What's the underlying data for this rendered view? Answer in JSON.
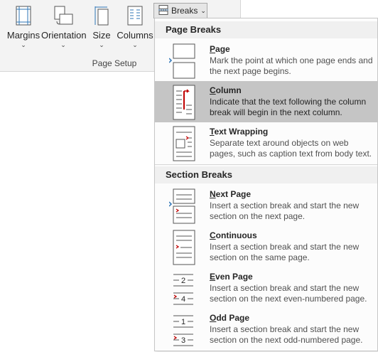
{
  "ribbon": {
    "group_label": "Page Setup",
    "buttons": [
      {
        "label": "Margins",
        "icon": "margins-icon"
      },
      {
        "label": "Orientation",
        "icon": "orientation-icon"
      },
      {
        "label": "Size",
        "icon": "size-icon"
      },
      {
        "label": "Columns",
        "icon": "columns-icon"
      }
    ],
    "breaks_label": "Breaks",
    "chevron": "⌄"
  },
  "menu": {
    "page_breaks_header": "Page Breaks",
    "section_breaks_header": "Section Breaks",
    "page_breaks": [
      {
        "mnemonic": "P",
        "rest": "age",
        "desc": "Mark the point at which one page ends and the next page begins.",
        "icon": "page-break-icon"
      },
      {
        "mnemonic": "C",
        "rest": "olumn",
        "desc": "Indicate that the text following the column break will begin in the next column.",
        "icon": "column-break-icon",
        "selected": true
      },
      {
        "mnemonic": "T",
        "rest": "ext Wrapping",
        "desc": "Separate text around objects on web pages, such as caption text from body text.",
        "icon": "text-wrapping-icon"
      }
    ],
    "section_breaks": [
      {
        "mnemonic": "N",
        "rest": "ext Page",
        "desc": "Insert a section break and start the new section on the next page.",
        "icon": "next-page-icon"
      },
      {
        "mnemonic": "C",
        "rest": "ontinuous",
        "desc": "Insert a section break and start the new section on the same page.",
        "icon": "continuous-icon"
      },
      {
        "mnemonic": "E",
        "rest": "ven Page",
        "desc": "Insert a section break and start the new section on the next even-numbered page.",
        "icon": "even-page-icon",
        "glyph_top": "2",
        "glyph_bottom": "4"
      },
      {
        "mnemonic": "O",
        "rest": "dd Page",
        "desc": "Insert a section break and start the new section on the next odd-numbered page.",
        "icon": "odd-page-icon",
        "glyph_top": "1",
        "glyph_bottom": "3"
      }
    ]
  },
  "colors": {
    "accent_red": "#c00000",
    "accent_blue": "#2e75b6",
    "selected_bg": "#c5c5c5"
  }
}
